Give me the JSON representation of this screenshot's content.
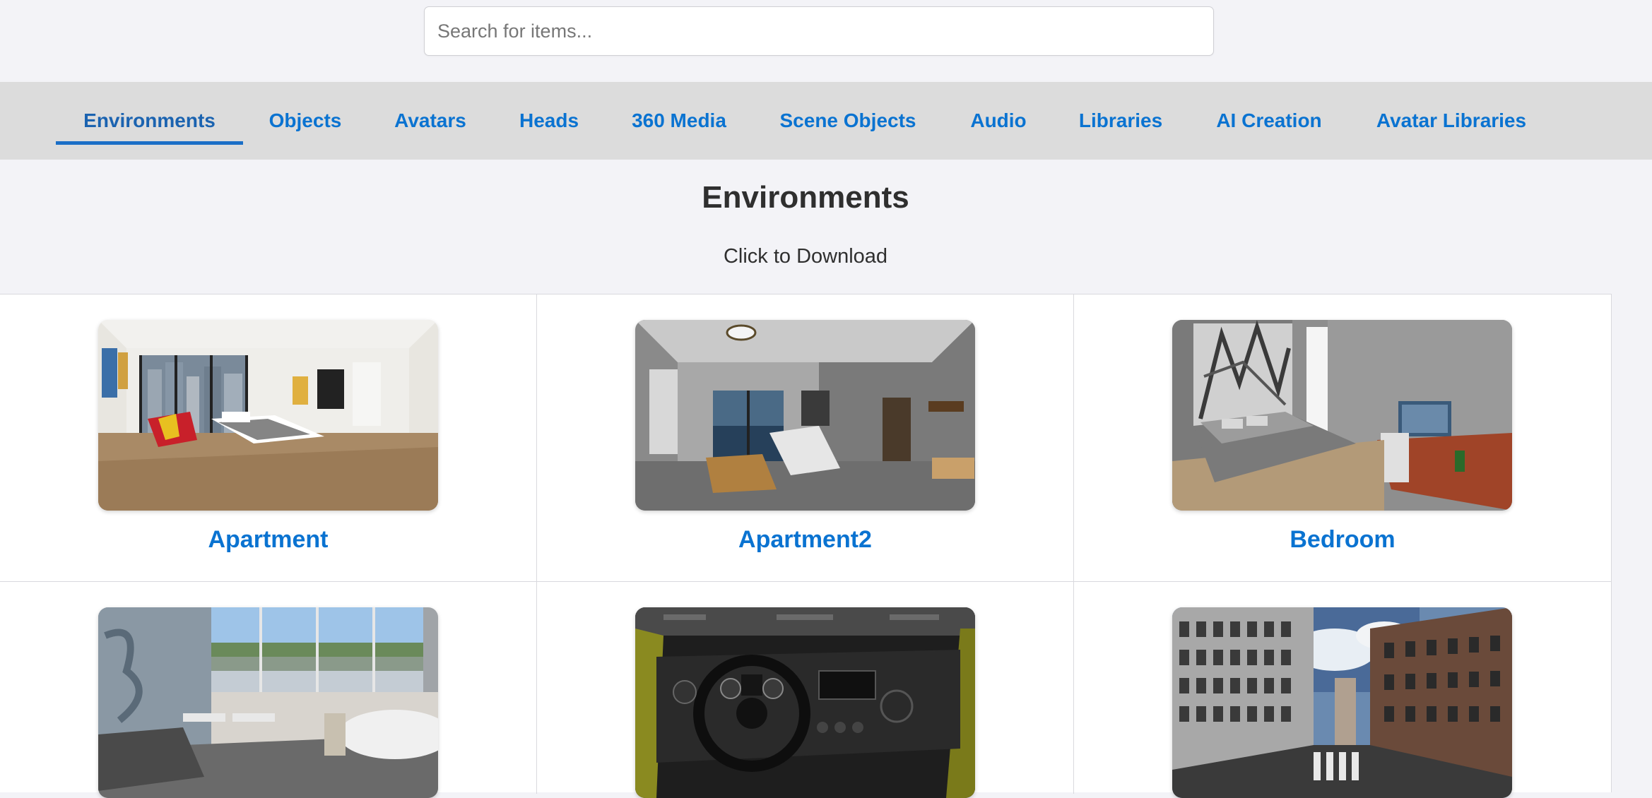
{
  "search": {
    "placeholder": "Search for items...",
    "value": ""
  },
  "tabs": [
    {
      "label": "Environments",
      "active": true
    },
    {
      "label": "Objects"
    },
    {
      "label": "Avatars"
    },
    {
      "label": "Heads"
    },
    {
      "label": "360 Media"
    },
    {
      "label": "Scene Objects"
    },
    {
      "label": "Audio"
    },
    {
      "label": "Libraries"
    },
    {
      "label": "AI Creation"
    },
    {
      "label": "Avatar Libraries"
    }
  ],
  "main": {
    "title": "Environments",
    "subtitle": "Click to Download",
    "items": [
      {
        "label": "Apartment"
      },
      {
        "label": "Apartment2"
      },
      {
        "label": "Bedroom"
      },
      {
        "label": ""
      },
      {
        "label": ""
      },
      {
        "label": ""
      }
    ]
  },
  "colors": {
    "accent": "#0a73d1",
    "tab_bar": "#dcdcdc",
    "page_bg": "#f3f3f7"
  }
}
